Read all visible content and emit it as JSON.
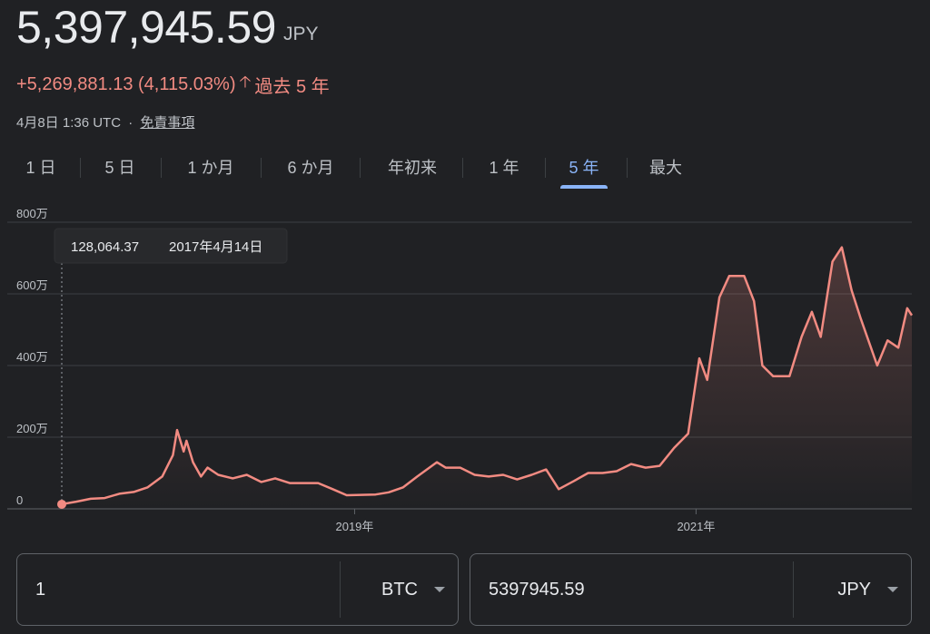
{
  "header": {
    "price": "5,397,945.59",
    "currency": "JPY",
    "change": "+5,269,881.13 (4,115.03%)",
    "change_arrow_icon": "arrow-up-icon",
    "period": "過去 5 年",
    "timestamp": "4月8日 1:36 UTC",
    "separator": "·",
    "disclaimer": "免責事項"
  },
  "tabs": [
    {
      "label": "1 日",
      "active": false
    },
    {
      "label": "5 日",
      "active": false
    },
    {
      "label": "1 か月",
      "active": false
    },
    {
      "label": "6 か月",
      "active": false
    },
    {
      "label": "年初来",
      "active": false
    },
    {
      "label": "1 年",
      "active": false
    },
    {
      "label": "5 年",
      "active": true
    },
    {
      "label": "最大",
      "active": false
    }
  ],
  "tooltip": {
    "value": "128,064.37",
    "date": "2017年4月14日"
  },
  "colors": {
    "line": "#f28b82",
    "accent": "#8ab4f8",
    "background": "#202124"
  },
  "chart_data": {
    "type": "area",
    "y_tick_labels": [
      "0",
      "200万",
      "400万",
      "600万",
      "800万"
    ],
    "y_ticks": [
      0,
      2000000,
      4000000,
      6000000,
      8000000
    ],
    "ylim": [
      0,
      8000000
    ],
    "x_tick_labels": [
      "2019年",
      "2021年"
    ],
    "x_ticks": [
      "2019-01-01",
      "2021-01-01"
    ],
    "xlim": [
      "2017-04-14",
      "2022-04-08"
    ],
    "grid": true,
    "series": [
      {
        "x": [
          "2017-04-14",
          "2017-05-15",
          "2017-06-15",
          "2017-07-15",
          "2017-08-15",
          "2017-09-15",
          "2017-10-15",
          "2017-11-15",
          "2017-12-08",
          "2017-12-17",
          "2017-12-31",
          "2018-01-06",
          "2018-01-20",
          "2018-02-06",
          "2018-02-20",
          "2018-03-15",
          "2018-04-15",
          "2018-05-15",
          "2018-06-15",
          "2018-07-15",
          "2018-08-15",
          "2018-09-15",
          "2018-10-15",
          "2018-11-15",
          "2018-12-15",
          "2019-01-15",
          "2019-02-15",
          "2019-03-15",
          "2019-04-15",
          "2019-05-15",
          "2019-06-26",
          "2019-07-15",
          "2019-08-15",
          "2019-09-15",
          "2019-10-15",
          "2019-11-15",
          "2019-12-15",
          "2020-01-15",
          "2020-02-15",
          "2020-03-13",
          "2020-04-15",
          "2020-05-15",
          "2020-06-15",
          "2020-07-15",
          "2020-08-15",
          "2020-09-15",
          "2020-10-15",
          "2020-11-15",
          "2020-12-15",
          "2021-01-08",
          "2021-01-25",
          "2021-02-20",
          "2021-03-13",
          "2021-04-14",
          "2021-05-05",
          "2021-05-23",
          "2021-06-15",
          "2021-07-20",
          "2021-08-15",
          "2021-09-06",
          "2021-09-25",
          "2021-10-20",
          "2021-11-09",
          "2021-11-30",
          "2021-12-20",
          "2022-01-24",
          "2022-02-15",
          "2022-03-10",
          "2022-03-29",
          "2022-04-08"
        ],
        "values": [
          128064,
          200000,
          280000,
          300000,
          420000,
          470000,
          600000,
          900000,
          1500000,
          2200000,
          1600000,
          1900000,
          1300000,
          900000,
          1150000,
          950000,
          850000,
          950000,
          750000,
          850000,
          720000,
          720000,
          720000,
          550000,
          380000,
          390000,
          400000,
          460000,
          600000,
          900000,
          1300000,
          1150000,
          1150000,
          950000,
          900000,
          950000,
          820000,
          950000,
          1100000,
          550000,
          780000,
          1000000,
          1000000,
          1050000,
          1250000,
          1150000,
          1200000,
          1700000,
          2100000,
          4200000,
          3600000,
          5900000,
          6500000,
          6500000,
          5800000,
          4000000,
          3700000,
          3700000,
          4800000,
          5500000,
          4800000,
          6900000,
          7300000,
          6100000,
          5300000,
          4000000,
          4700000,
          4500000,
          5600000,
          5400000
        ]
      }
    ]
  },
  "converter": {
    "from_value": "1",
    "from_currency": "BTC",
    "to_value": "5397945.59",
    "to_currency": "JPY"
  }
}
